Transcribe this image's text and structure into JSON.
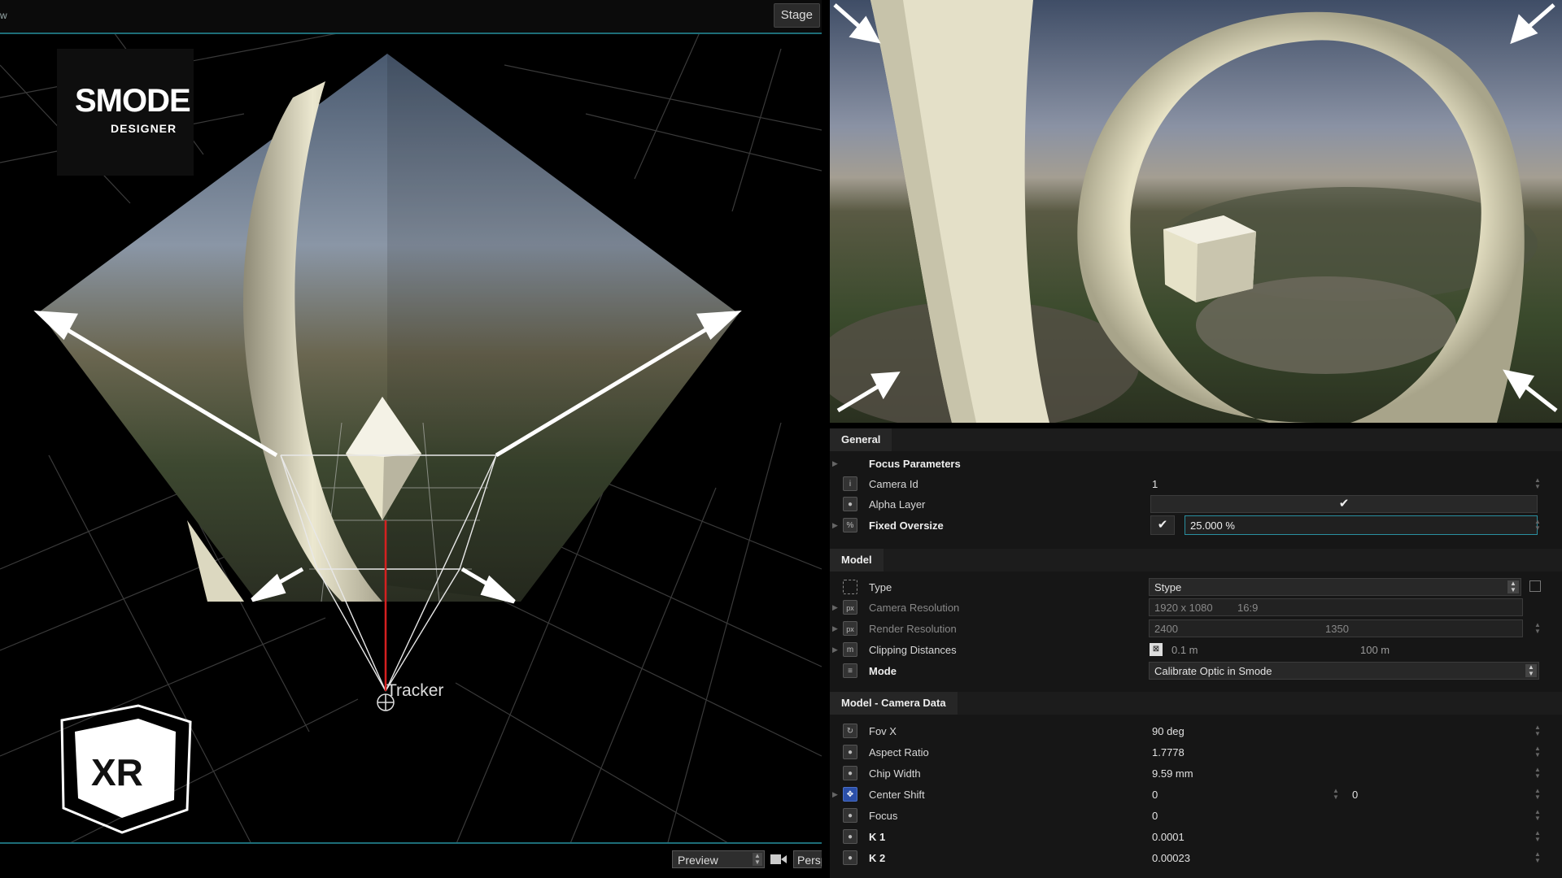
{
  "left_viewport": {
    "title_fragment": "w",
    "stage_button": "Stage",
    "preview_label": "Preview",
    "persp_label": "Persp",
    "tracker_label": "Tracker",
    "logo_word": "SMODE",
    "logo_sub": "DESIGNER",
    "xr_badge": "XR"
  },
  "properties": {
    "general": {
      "title": "General",
      "focus_parameters": "Focus Parameters",
      "camera_id_label": "Camera Id",
      "camera_id_value": "1",
      "alpha_layer_label": "Alpha Layer",
      "fixed_oversize_label": "Fixed Oversize",
      "fixed_oversize_value": "25.000 %"
    },
    "model": {
      "title": "Model",
      "type_label": "Type",
      "type_value": "Stype",
      "camera_resolution_label": "Camera Resolution",
      "camera_resolution_value": "1920 x 1080",
      "camera_resolution_ratio": "16:9",
      "render_resolution_label": "Render Resolution",
      "render_resolution_w": "2400",
      "render_resolution_h": "1350",
      "clipping_label": "Clipping Distances",
      "clipping_near": "0.1 m",
      "clipping_far": "100 m",
      "mode_label": "Mode",
      "mode_value": "Calibrate Optic in Smode"
    },
    "camera_data": {
      "title": "Model - Camera Data",
      "fovx_label": "Fov X",
      "fovx_value": "90 deg",
      "aspect_label": "Aspect Ratio",
      "aspect_value": "1.7778",
      "chip_label": "Chip Width",
      "chip_value": "9.59 mm",
      "center_label": "Center Shift",
      "center_x": "0",
      "center_y": "0",
      "focus_label": "Focus",
      "focus_value": "0",
      "k1_label": "K 1",
      "k1_value": "0.0001",
      "k2_label": "K 2",
      "k2_value": "0.00023"
    }
  },
  "colors": {
    "accent": "#1d6d78",
    "object_ivory": "#e6e2c8",
    "panel_bg": "#161616"
  }
}
